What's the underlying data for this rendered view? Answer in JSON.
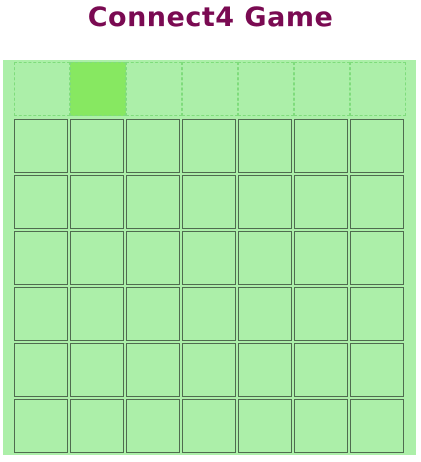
{
  "title": "Connect4 Game",
  "board": {
    "columns": 7,
    "rows": 6,
    "hovered_column": 2,
    "cells": [
      [
        "",
        "",
        "",
        "",
        "",
        "",
        ""
      ],
      [
        "",
        "",
        "",
        "",
        "",
        "",
        ""
      ],
      [
        "",
        "",
        "",
        "",
        "",
        "",
        ""
      ],
      [
        "",
        "",
        "",
        "",
        "",
        "",
        ""
      ],
      [
        "",
        "",
        "",
        "",
        "",
        "",
        ""
      ],
      [
        "",
        "",
        "",
        "",
        "",
        "",
        ""
      ]
    ]
  },
  "colors": {
    "title": "#7a0a52",
    "board_background": "#acefa9",
    "hover_highlight": "#87e861",
    "cell_border": "#4f6b4f",
    "drop_border": "#7fdc7c"
  }
}
